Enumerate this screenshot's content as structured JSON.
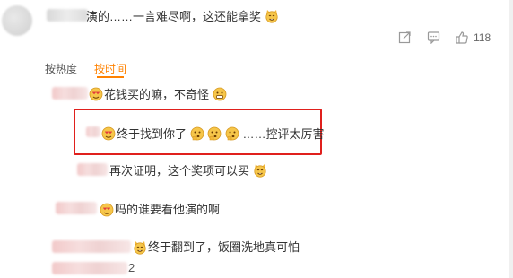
{
  "top_comment": {
    "text": "演的……一言难尽啊，这还能拿奖",
    "emoji": "cat-grin-emoji",
    "like_count": "118"
  },
  "sort_tabs": {
    "by_hot": "按热度",
    "by_time": "按时间"
  },
  "replies": [
    {
      "text": "花钱买的嘛，不奇怪",
      "emojis": [
        "grimace-emoji"
      ]
    },
    {
      "text": "终于找到你了",
      "suffix": "……控评太厉害",
      "emojis": [
        "thinking-emoji",
        "thinking-emoji",
        "thinking-emoji"
      ]
    },
    {
      "text": "再次证明，这个奖项可以买",
      "emojis": [
        "cat-grin-emoji"
      ]
    },
    {
      "text": "吗的谁要看他演的啊",
      "emojis": []
    },
    {
      "text": "终于翻到了，饭圈洗地真可怕",
      "emojis": []
    }
  ],
  "reply_fragment": "2",
  "colors": {
    "accent": "#ff8200",
    "highlight_border": "#e0201d",
    "muted": "#888888"
  }
}
